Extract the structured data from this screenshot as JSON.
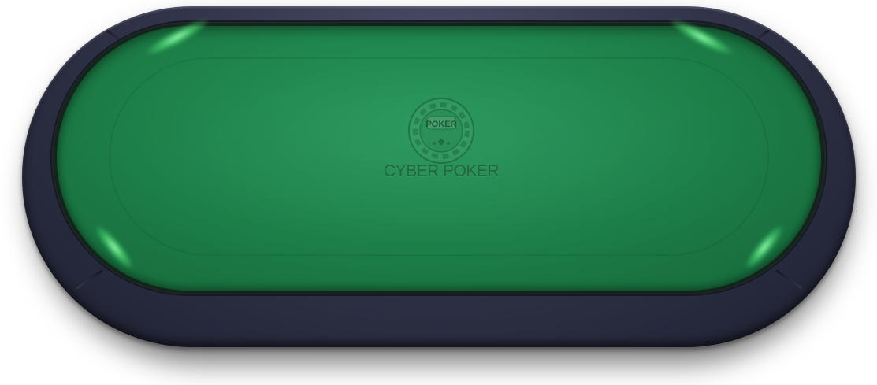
{
  "table": {
    "logo_text": "POKER",
    "brand_name": "CYBER POKER"
  },
  "colors": {
    "felt": "#20894f",
    "rail": "#32344a",
    "glow": "#7dff9e"
  },
  "icons": {
    "center_logo": "poker-chip-icon"
  }
}
